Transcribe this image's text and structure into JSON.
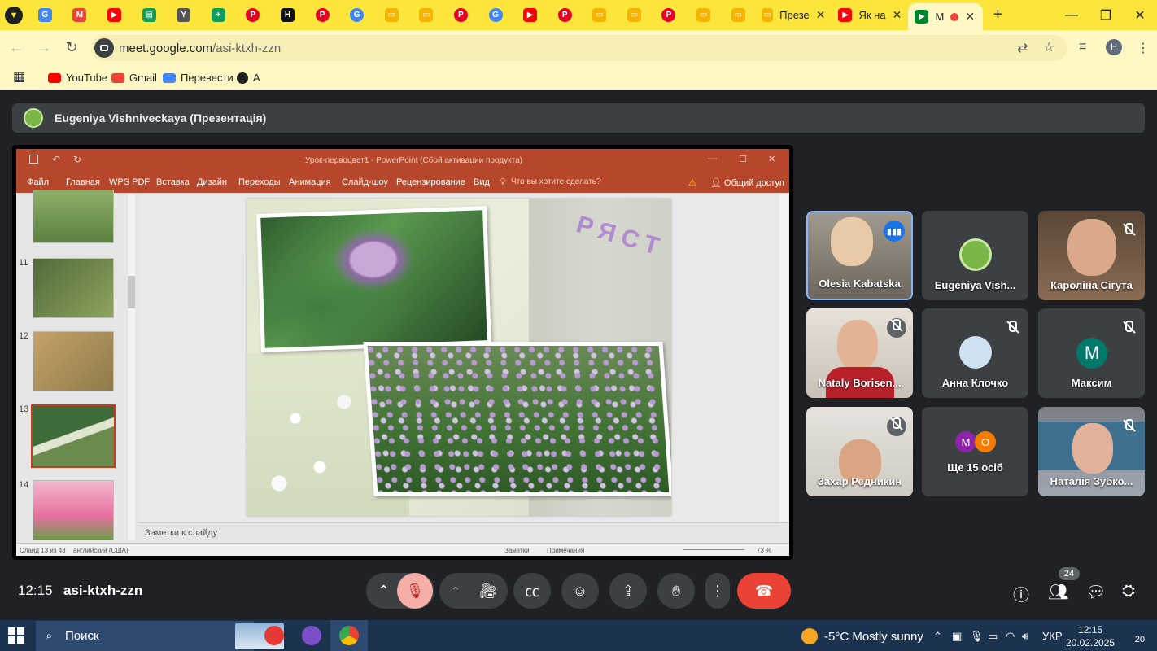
{
  "browser": {
    "tabs": [
      {
        "label": "Презе",
        "icon": "slides-icon"
      },
      {
        "label": "Як на",
        "icon": "youtube-icon"
      },
      {
        "label": "M",
        "icon": "meet-icon"
      }
    ],
    "address": {
      "domain": "meet.google.com",
      "path": "/asi-ktxh-zzn"
    },
    "profile_initial": "Н",
    "bookmarks": [
      {
        "label": "YouTube",
        "color": "#ff0000"
      },
      {
        "label": "Gmail",
        "color": "#ea4335"
      },
      {
        "label": "Перевести",
        "color": "#4285f4"
      },
      {
        "label": "А",
        "color": "#222222"
      }
    ]
  },
  "meet": {
    "presenter_title": "Eugeniya Vishniveckaya (Презентація)",
    "meeting_time": "12:15",
    "meeting_code": "asi-ktxh-zzn",
    "participants_count": "24",
    "end_call_color": "#ea4335",
    "tiles": [
      {
        "name": "Olesia Kabatska",
        "speaking": true
      },
      {
        "name": "Eugeniya Vish...",
        "speaking": false
      },
      {
        "name": "Кароліна Сігута",
        "muted": true
      },
      {
        "name": "Nataly Borisen...",
        "muted": true
      },
      {
        "name": "Анна Клочко",
        "muted": true
      },
      {
        "name": "Максим",
        "initial": "М",
        "muted": true
      },
      {
        "name": "Захар Редникин",
        "muted": true
      },
      {
        "name": "Ще 15 осіб",
        "initials": [
          "М",
          "O"
        ]
      },
      {
        "name": "Наталія Зубко...",
        "muted": true
      }
    ]
  },
  "powerpoint": {
    "title": "Урок-первоцвет1 - PowerPoint (Сбой активации продукта)",
    "ribbon": [
      "Файл",
      "Главная",
      "WPS PDF",
      "Вставка",
      "Дизайн",
      "Переходы",
      "Анимация",
      "Слайд-шоу",
      "Рецензирование",
      "Вид"
    ],
    "tell_me": "Что вы хотите сделать?",
    "share": "Общий доступ",
    "slide_numbers": [
      "11",
      "12",
      "13",
      "14"
    ],
    "slide_word": "РЯСТ",
    "notes_placeholder": "Заметки к слайду",
    "status_slide": "Слайд 13 из 43",
    "status_lang": "английский (США)",
    "status_notes": "Заметки",
    "status_comments": "Примечания",
    "zoom": "73 %"
  },
  "taskbar": {
    "search_placeholder": "Поиск",
    "weather": "-5°C  Mostly sunny",
    "lang": "УКР",
    "time": "12:15",
    "date": "20.02.2025",
    "notifications": "20"
  }
}
